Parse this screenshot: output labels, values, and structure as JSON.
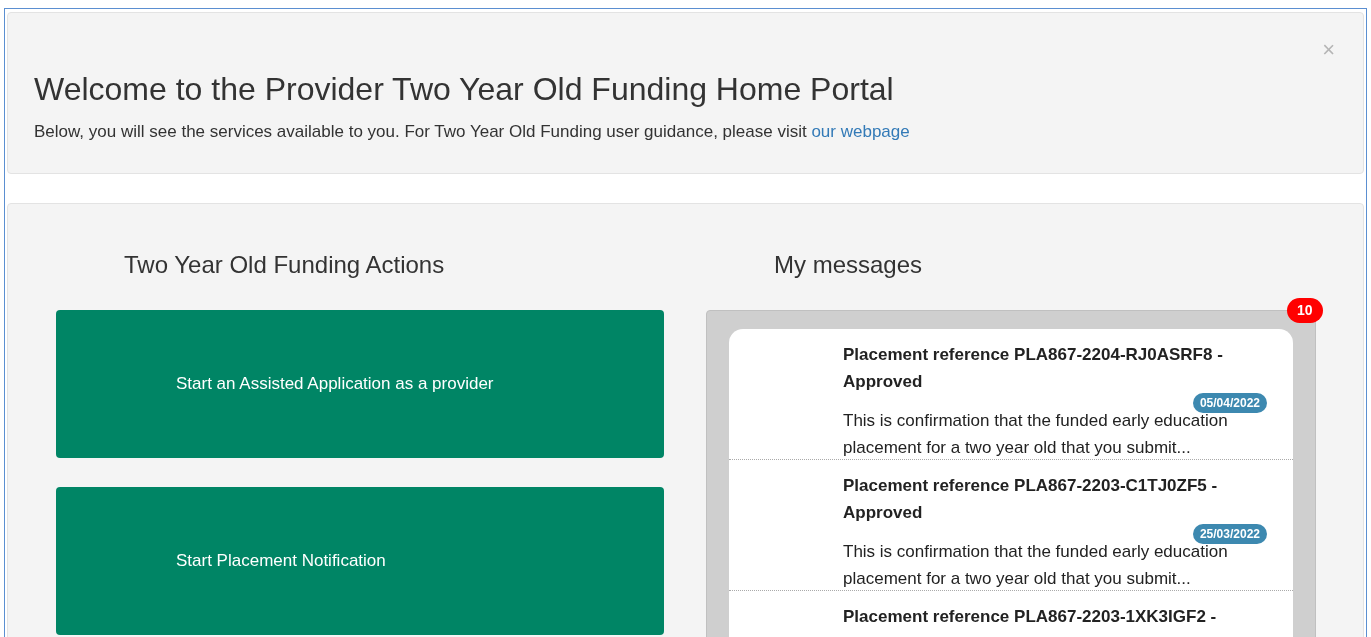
{
  "header": {
    "title": "Welcome to the Provider Two Year Old Funding Home Portal",
    "intro": "Below, you will see the services available to you. For Two Year Old Funding user guidance, please visit",
    "link": "our webpage",
    "close": "×"
  },
  "actions": {
    "heading": "Two Year Old Funding Actions",
    "buttons": [
      "Start an Assisted Application as a provider",
      "Start Placement Notification"
    ]
  },
  "messages": {
    "heading": "My messages",
    "count": "10",
    "items": [
      {
        "title": "Placement reference PLA867-2204-RJ0ASRF8 - Approved",
        "date": "05/04/2022",
        "body": "This is confirmation that the funded early education placement for a two year old that you submit..."
      },
      {
        "title": "Placement reference PLA867-2203-C1TJ0ZF5 - Approved",
        "date": "25/03/2022",
        "body": "This is confirmation that the funded early education placement for a two year old that you submit..."
      },
      {
        "title": "Placement reference PLA867-2203-1XK3IGF2 -"
      }
    ]
  }
}
